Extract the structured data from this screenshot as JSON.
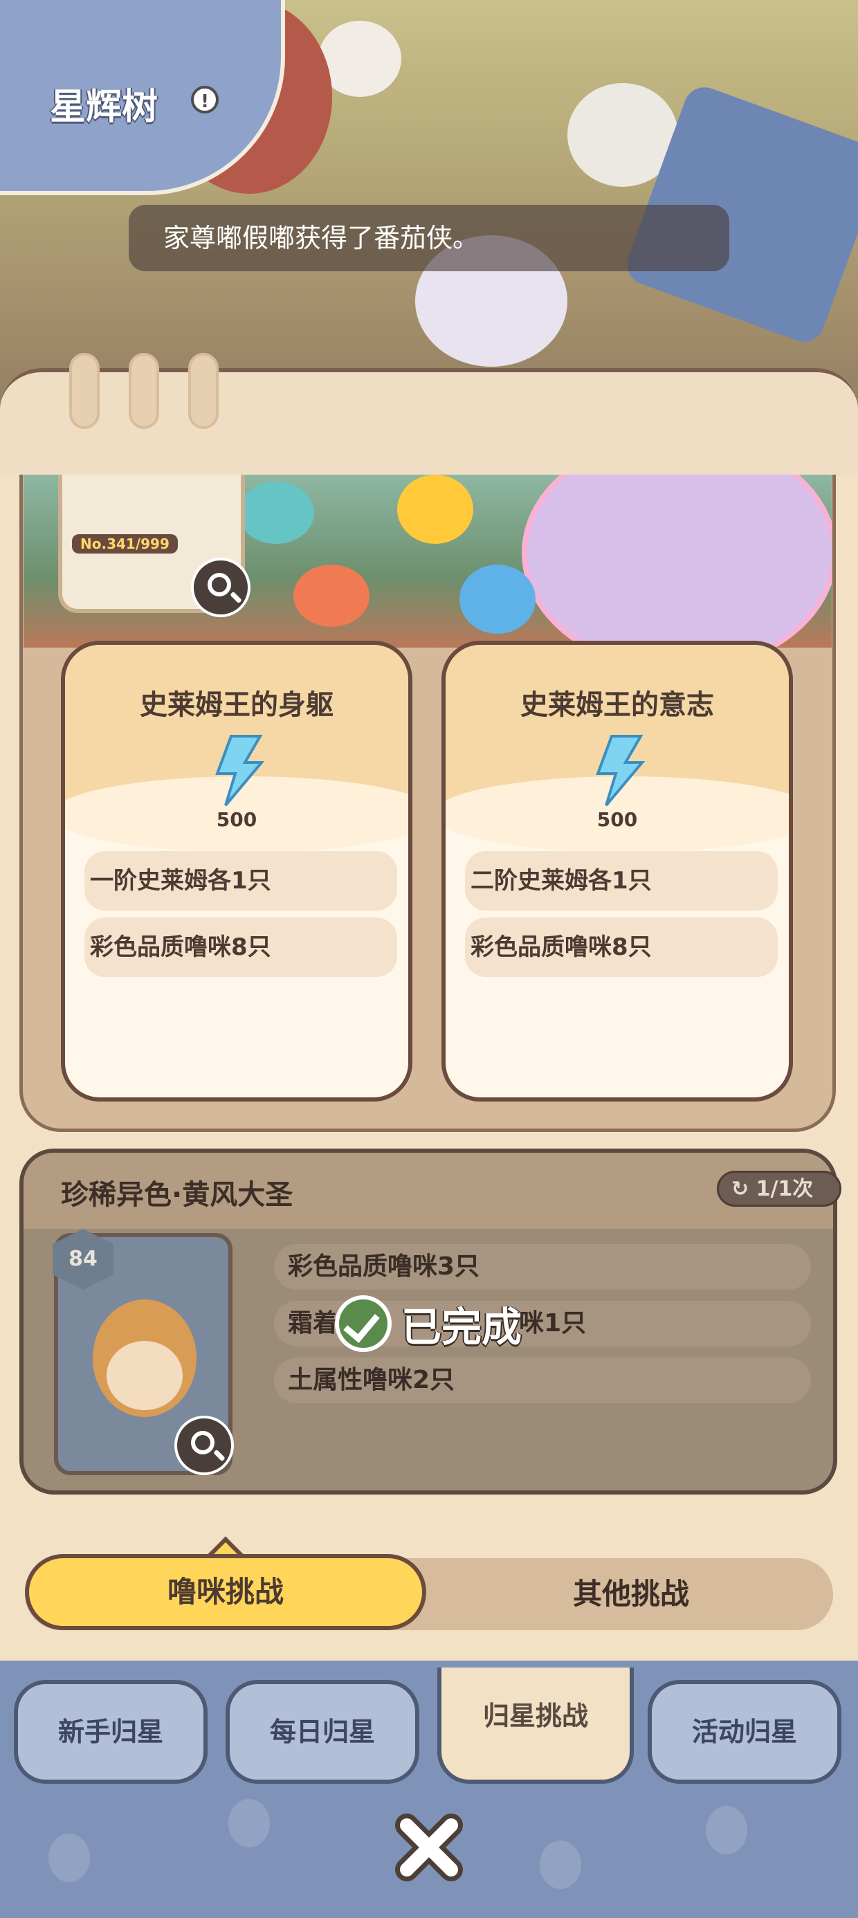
{
  "header": {
    "title": "星辉树",
    "notice": "家尊嘟假嘟获得了番茄侠。"
  },
  "slime_panel": {
    "portrait_no": "No.341/999",
    "cards": [
      {
        "title": "史莱姆王的身躯",
        "reward_value": "500",
        "requirements": [
          "一阶史莱姆各1只",
          "彩色品质噜咪8只"
        ]
      },
      {
        "title": "史莱姆王的意志",
        "reward_value": "500",
        "requirements": [
          "二阶史莱姆各1只",
          "彩色品质噜咪8只"
        ]
      }
    ]
  },
  "rare_panel": {
    "title": "珍稀异色·黄风大圣",
    "attempts": "1/1次",
    "level": "84",
    "requirements": [
      "彩色品质噜咪3只",
      "霜着",
      "咪1只",
      "土属性噜咪2只"
    ],
    "status": "已完成"
  },
  "challenge_tabs": [
    "噜咪挑战",
    "其他挑战"
  ],
  "nav": [
    "新手归星",
    "每日归星",
    "归星挑战",
    "活动归星"
  ],
  "colors": {
    "accent_yellow": "#ffd65a",
    "nav_blue": "#7f93b8",
    "paper": "#f3e1c6",
    "text_brown": "#4d3a32"
  }
}
